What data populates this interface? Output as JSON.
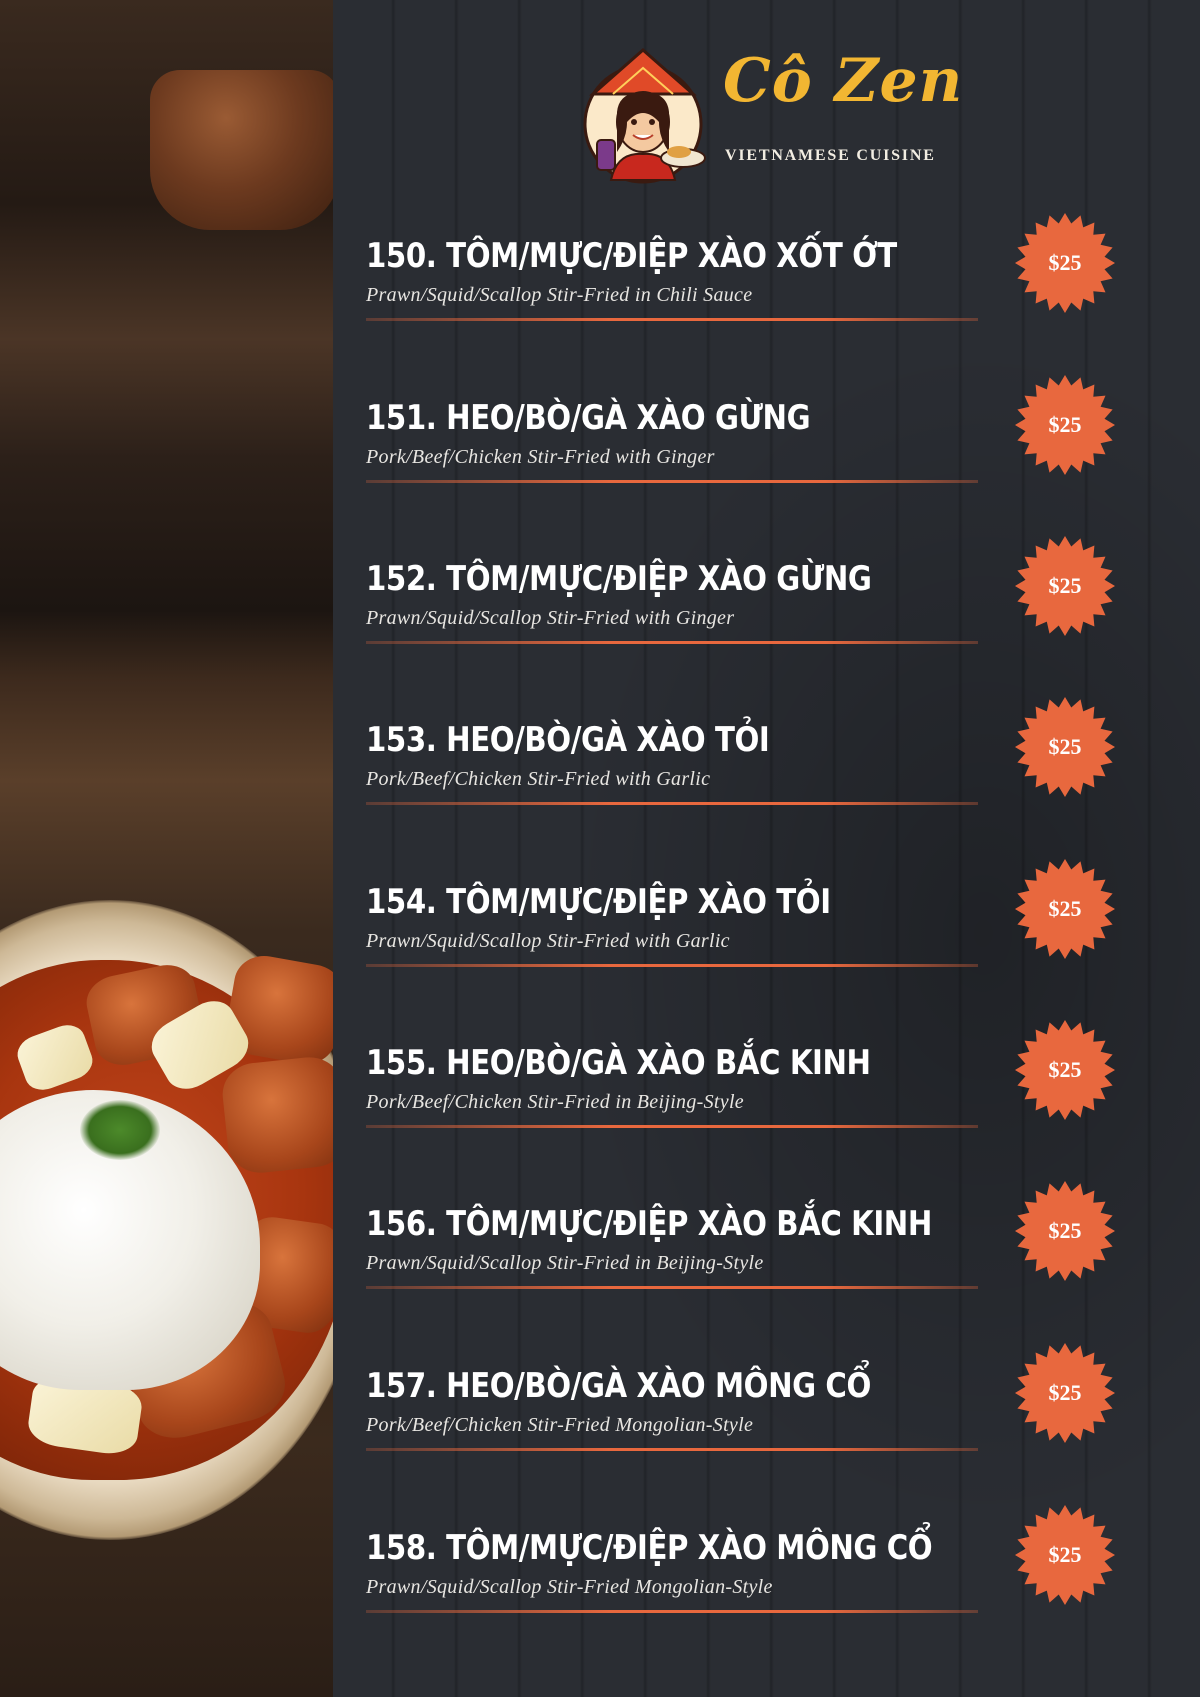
{
  "brand": {
    "name": "Cô Zen",
    "tagline": "VIETNAMESE CUISINE"
  },
  "colors": {
    "accent": "#e8683e",
    "brand_yellow": "#f2b632",
    "panel_bg": "#2a2d33"
  },
  "photo": {
    "description_icon": "food-photo-rice-sweet-sour"
  },
  "menu_items": [
    {
      "name": "150. TÔM/MỰC/ĐIỆP XÀO XỐT ỚT",
      "desc": "Prawn/Squid/Scallop Stir-Fried in Chili Sauce",
      "price": "$25"
    },
    {
      "name": "151. HEO/BÒ/GÀ XÀO GỪNG",
      "desc": "Pork/Beef/Chicken Stir-Fried with Ginger",
      "price": "$25"
    },
    {
      "name": "152. TÔM/MỰC/ĐIỆP XÀO GỪNG",
      "desc": "Prawn/Squid/Scallop Stir-Fried with Ginger",
      "price": "$25"
    },
    {
      "name": "153. HEO/BÒ/GÀ XÀO TỎI",
      "desc": "Pork/Beef/Chicken Stir-Fried with Garlic",
      "price": "$25"
    },
    {
      "name": "154. TÔM/MỰC/ĐIỆP XÀO TỎI",
      "desc": "Prawn/Squid/Scallop Stir-Fried with Garlic",
      "price": "$25"
    },
    {
      "name": "155. HEO/BÒ/GÀ XÀO BẮC KINH",
      "desc": "Pork/Beef/Chicken Stir-Fried in Beijing-Style",
      "price": "$25"
    },
    {
      "name": "156. TÔM/MỰC/ĐIỆP XÀO BẮC KINH",
      "desc": "Prawn/Squid/Scallop Stir-Fried in Beijing-Style",
      "price": "$25"
    },
    {
      "name": "157. HEO/BÒ/GÀ XÀO MÔNG CỔ",
      "desc": "Pork/Beef/Chicken Stir-Fried Mongolian-Style",
      "price": "$25"
    },
    {
      "name": "158. TÔM/MỰC/ĐIỆP XÀO MÔNG CỔ",
      "desc": "Prawn/Squid/Scallop Stir-Fried Mongolian-Style",
      "price": "$25"
    }
  ]
}
